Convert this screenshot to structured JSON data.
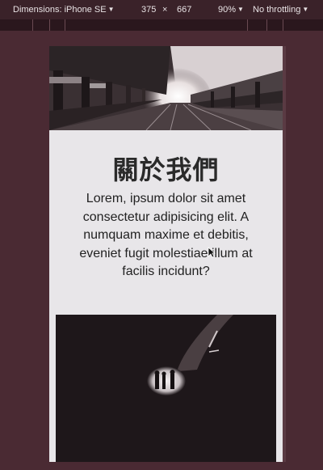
{
  "toolbar": {
    "device_label": "Dimensions: iPhone SE",
    "width": "375",
    "times": "×",
    "height": "667",
    "zoom": "90%",
    "throttling": "No throttling"
  },
  "page": {
    "title": "關於我們",
    "body": "Lorem, ipsum dolor sit amet consectetur adipisicing elit. A numquam maxime et debitis, eveniet fugit molestiae illum at facilis incidunt?"
  },
  "icons": {
    "dropdown": "chevron-down-icon",
    "cursor": "mouse-pointer-icon"
  }
}
